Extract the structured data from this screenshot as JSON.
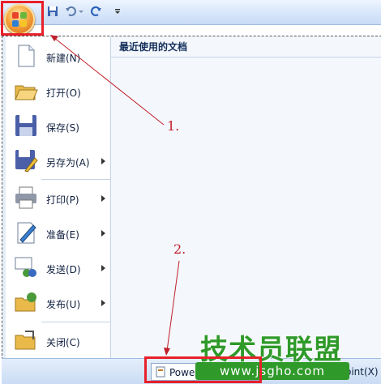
{
  "menu": {
    "items": [
      {
        "label": "新建(N)",
        "icon": "new-document-icon",
        "submenu": false
      },
      {
        "label": "打开(O)",
        "icon": "open-folder-icon",
        "submenu": false
      },
      {
        "label": "保存(S)",
        "icon": "save-disk-icon",
        "submenu": false
      },
      {
        "label": "另存为(A)",
        "icon": "save-as-icon",
        "submenu": true
      },
      {
        "label": "打印(P)",
        "icon": "printer-icon",
        "submenu": true
      },
      {
        "label": "准备(E)",
        "icon": "prepare-icon",
        "submenu": true
      },
      {
        "label": "发送(D)",
        "icon": "send-icon",
        "submenu": true
      },
      {
        "label": "发布(U)",
        "icon": "publish-icon",
        "submenu": true
      },
      {
        "label": "关闭(C)",
        "icon": "close-folder-icon",
        "submenu": false
      }
    ]
  },
  "recent": {
    "title": "最近使用的文档"
  },
  "bottom": {
    "options_label": "Powe",
    "exit_label": "oint(X)"
  },
  "watermark": {
    "title": "技术员联盟",
    "url": "www.jsgho.com"
  },
  "annotations": {
    "one": "1.",
    "two": "2."
  },
  "colors": {
    "accent_red": "#e8202a",
    "annotation_red": "#c0202a",
    "watermark_green": "#2f9a2a"
  }
}
